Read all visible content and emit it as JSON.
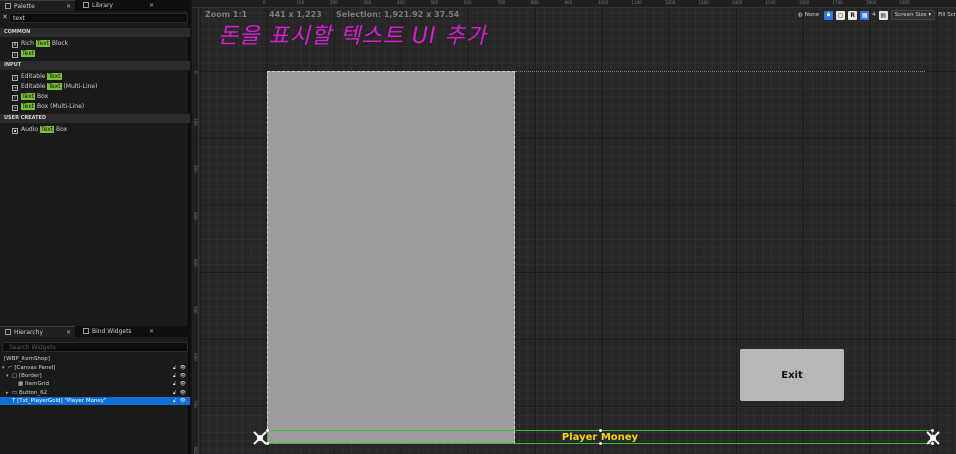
{
  "palette_panel": {
    "tab_palette": "Palette",
    "tab_library": "Library",
    "search_value": "text",
    "categories": {
      "common": "COMMON",
      "input": "INPUT",
      "user_created": "USER CREATED"
    },
    "common_items": [
      {
        "pre": "Rich ",
        "hl": "Text",
        "post": " Block"
      },
      {
        "pre": "",
        "hl": "Text",
        "post": ""
      }
    ],
    "input_items": [
      {
        "pre": "Editable ",
        "hl": "Text",
        "post": ""
      },
      {
        "pre": "Editable ",
        "hl": "Text",
        "post": " (Multi-Line)"
      },
      {
        "pre": "",
        "hl": "Text",
        "post": " Box"
      },
      {
        "pre": "",
        "hl": "Text",
        "post": " Box (Multi-Line)"
      }
    ],
    "user_items": [
      {
        "pre": "Audio ",
        "hl": "Text",
        "post": " Box"
      }
    ]
  },
  "hierarchy_panel": {
    "tab_hierarchy": "Hierarchy",
    "tab_bind": "Bind Widgets",
    "search_placeholder": "Search Widgets",
    "rows": [
      "[WBP_ItemShop]",
      "[Canvas Panel]",
      "[Border]",
      "ItemGrid",
      "Button_62",
      "[Txt_PlayerGold] \"Player Money\""
    ]
  },
  "canvas": {
    "zoom": "Zoom 1:1",
    "resolution": "441 x 1,223",
    "selection": "Selection: 1,921.92 x 37.54",
    "annotation": "돈을 표시할 텍스트 UI 추가",
    "exit_label": "Exit",
    "money_label": "Player Money",
    "ruler_top": [
      "0",
      "100",
      "200",
      "300",
      "400",
      "500",
      "600",
      "700",
      "800",
      "900",
      "1000",
      "1100",
      "1200",
      "1300",
      "1400",
      "1500",
      "1600",
      "1700",
      "1800",
      "1900"
    ],
    "ruler_left": [
      "0",
      "100",
      "200",
      "300",
      "400",
      "500",
      "600",
      "700",
      "800"
    ],
    "toolbar": {
      "none": "None",
      "r_label": "R",
      "grid_value": "4",
      "screen_size": "Screen Size",
      "fill_screen": "Fill Scr"
    }
  },
  "colors": {
    "selection_blue": "#0d6fd6",
    "highlight_green": "#7ac036",
    "annotation_magenta": "#d51fd0",
    "money_yellow": "#f7d21c",
    "money_border_green": "#34c234"
  }
}
